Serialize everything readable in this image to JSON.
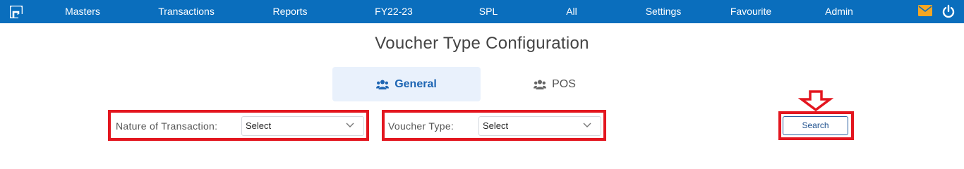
{
  "nav": {
    "items": [
      "Masters",
      "Transactions",
      "Reports",
      "FY22-23",
      "SPL",
      "All",
      "Settings",
      "Favourite",
      "Admin"
    ]
  },
  "page": {
    "title": "Voucher Type Configuration"
  },
  "tabs": [
    {
      "label": "General",
      "icon": "users-icon",
      "active": true
    },
    {
      "label": "POS",
      "icon": "users-icon",
      "active": false
    }
  ],
  "filters": {
    "nature": {
      "label": "Nature of Transaction:",
      "value": "Select"
    },
    "voucher_type": {
      "label": "Voucher Type:",
      "value": "Select"
    }
  },
  "search": {
    "label": "Search"
  },
  "colors": {
    "header": "#0a6ebd",
    "accent": "#1d65b3",
    "highlight": "#e3161f",
    "mail": "#f5a623"
  }
}
